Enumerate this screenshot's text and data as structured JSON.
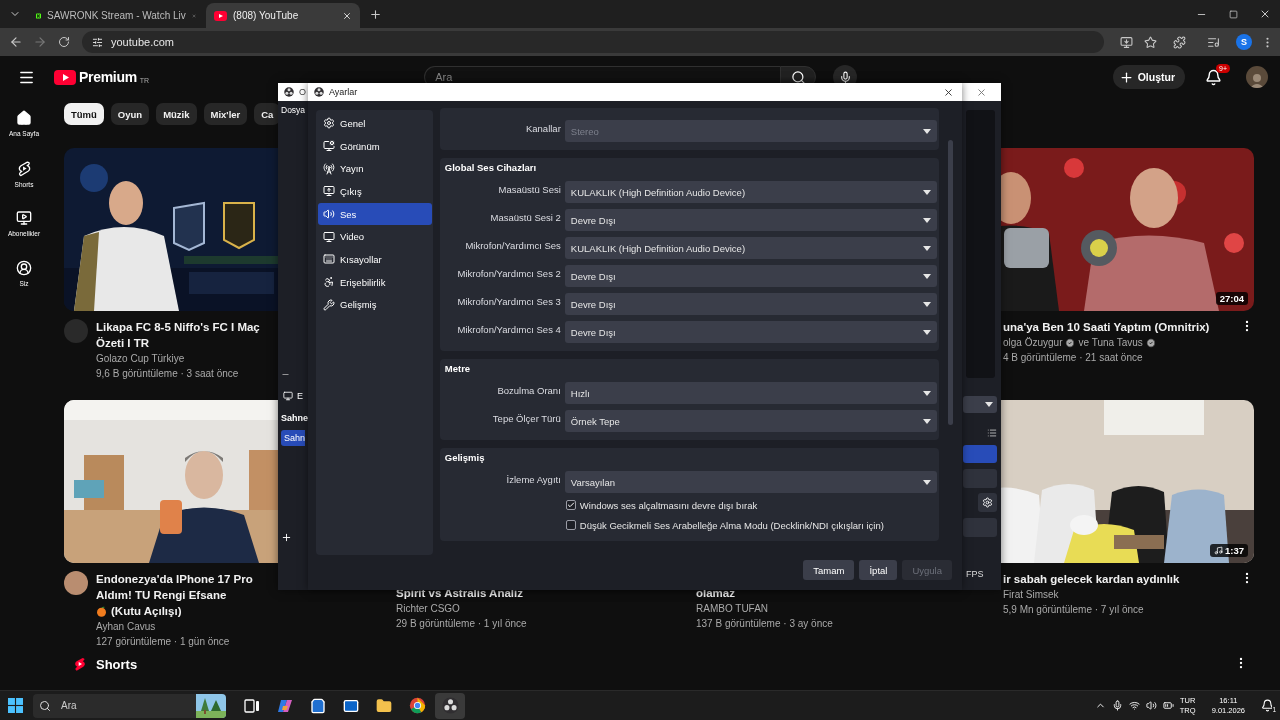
{
  "browser": {
    "tabs": [
      {
        "title": "SAWRONK Stream - Watch Liv",
        "kind": "stream",
        "selected": false
      },
      {
        "title": "(808) YouTube",
        "kind": "video",
        "selected": true
      }
    ],
    "url": "youtube.com",
    "profile_initial": "S"
  },
  "youtube": {
    "logo": "Premium",
    "region": "TR",
    "search": {
      "placeholder": "Ara"
    },
    "create": "Oluştur",
    "notifications": "9+",
    "nav": [
      {
        "label": "Ana Sayfa",
        "kind": "home"
      },
      {
        "label": "Shorts",
        "kind": "shorts"
      },
      {
        "label": "Abonelikler",
        "kind": "subscriptions"
      },
      {
        "label": "Siz",
        "kind": "you"
      }
    ],
    "chips": [
      {
        "label": "Tümü",
        "selected": true
      },
      {
        "label": "Oyun",
        "selected": false
      },
      {
        "label": "Müzik",
        "selected": false
      },
      {
        "label": "Mix'ler",
        "selected": false
      },
      {
        "label": "Ca",
        "selected": false
      }
    ],
    "videos": [
      {
        "thumbnail": {
          "kind": "picture"
        },
        "title": "Likapa FC 8-5 Niffo's FC I Maç Özeti I TR",
        "channel": [
          {
            "name": "Golazo Cup Türkiye"
          }
        ],
        "stats": "9,6 B görüntüleme · 3 saat önce"
      },
      {
        "thumbnail": {
          "kind": "picture",
          "duration": "27:04",
          "music": false
        },
        "title": "una'ya Ben 10 Saati Yaptım (Omnitrix)",
        "channel": [
          {
            "name": "olga Özuygur",
            "verified": true
          },
          {
            "name": "ve Tuna Tavus",
            "verified": true
          }
        ],
        "stats": "4 B görüntüleme · 21 saat önce"
      },
      {
        "thumbnail": {
          "kind": "picture"
        },
        "title": "Endonezya'da IPhone 17 Pro Aldım! TU Rengi Efsane",
        "title_end": "(Kutu Açılışı)",
        "channel": [
          {
            "name": "Ayhan Cavus"
          }
        ],
        "stats": "127 görüntüleme · 1 gün önce"
      },
      {
        "title": "Spirit vs Astralis Analiz",
        "title_starts_hidden": true,
        "channel": [
          {
            "name": "Richter CSGO"
          }
        ],
        "stats": "29 B görüntüleme · 1 yıl önce"
      },
      {
        "title": "olamaz",
        "title_starts_hidden": true,
        "channel": [
          {
            "name": "RAMBO TUFAN"
          }
        ],
        "stats": "137 B görüntüleme · 3 ay önce"
      },
      {
        "thumbnail": {
          "kind": "picture",
          "duration": "1:37",
          "music": true
        },
        "title": "ir sabah gelecek kardan aydınlık",
        "channel": [
          {
            "name": "Firat Simsek"
          }
        ],
        "stats": "5,9 Mn görüntüleme · 7 yıl önce"
      }
    ],
    "shorts_title": "Shorts"
  },
  "obs_main": {
    "title": "O",
    "menu": "Dosya",
    "source_label": "E",
    "scenes_title": "Sahne",
    "scenes": [
      {
        "label": "Sahn",
        "selected": true
      }
    ],
    "fps_label": "FPS"
  },
  "settings": {
    "title": "Ayarlar",
    "nav": [
      {
        "label": "Genel",
        "kind": "general",
        "selected": false
      },
      {
        "label": "Görünüm",
        "kind": "appearance",
        "selected": false
      },
      {
        "label": "Yayın",
        "kind": "stream",
        "selected": false
      },
      {
        "label": "Çıkış",
        "kind": "output",
        "selected": false
      },
      {
        "label": "Ses",
        "kind": "audio",
        "selected": true
      },
      {
        "label": "Video",
        "kind": "video",
        "selected": false
      },
      {
        "label": "Kısayollar",
        "kind": "hotkeys",
        "selected": false
      },
      {
        "label": "Erişebilirlik",
        "kind": "accessibility",
        "selected": false
      },
      {
        "label": "Gelişmiş",
        "kind": "advanced",
        "selected": false
      }
    ],
    "groups": [
      {
        "rows": [
          {
            "kind": "select",
            "label": "Kanallar",
            "value": "Stereo",
            "disabled": true
          }
        ]
      },
      {
        "title": "Global Ses Cihazları",
        "rows": [
          {
            "kind": "select",
            "label": "Masaüstü Sesi",
            "value": "KULAKLIK (High Definition Audio Device)",
            "disabled": false
          },
          {
            "kind": "select",
            "label": "Masaüstü Sesi 2",
            "value": "Devre Dışı",
            "disabled": false
          },
          {
            "kind": "select",
            "label": "Mikrofon/Yardımcı Ses",
            "value": "KULAKLIK (High Definition Audio Device)",
            "disabled": false
          },
          {
            "kind": "select",
            "label": "Mikrofon/Yardımcı Ses 2",
            "value": "Devre Dışı",
            "disabled": false
          },
          {
            "kind": "select",
            "label": "Mikrofon/Yardımcı Ses 3",
            "value": "Devre Dışı",
            "disabled": false
          },
          {
            "kind": "select",
            "label": "Mikrofon/Yardımcı Ses 4",
            "value": "Devre Dışı",
            "disabled": false
          }
        ]
      },
      {
        "title": "Metre",
        "rows": [
          {
            "kind": "select",
            "label": "Bozulma Oranı",
            "value": "Hızlı",
            "disabled": false
          },
          {
            "kind": "select",
            "label": "Tepe Ölçer Türü",
            "value": "Örnek Tepe",
            "disabled": false
          }
        ]
      },
      {
        "title": "Gelişmiş",
        "rows": [
          {
            "kind": "select",
            "label": "İzleme Aygıtı",
            "value": "Varsayılan",
            "disabled": false
          },
          {
            "kind": "checkbox",
            "label": "Windows ses alçaltmasını devre dışı bırak",
            "checked": true
          },
          {
            "kind": "checkbox",
            "label": "Düşük Gecikmeli Ses Arabelleğe Alma Modu (Decklink/NDI çıkışları için)",
            "checked": false
          }
        ]
      }
    ],
    "buttons": [
      {
        "label": "Tamam",
        "disabled": false
      },
      {
        "label": "İptal",
        "disabled": false
      },
      {
        "label": "Uygula",
        "disabled": true
      }
    ]
  },
  "taskbar": {
    "search": {
      "placeholder": "Ara"
    },
    "apps": [
      {
        "kind": "taskview",
        "active": false
      },
      {
        "kind": "assistant",
        "active": false
      },
      {
        "kind": "store",
        "active": false
      },
      {
        "kind": "mail",
        "active": false
      },
      {
        "kind": "files",
        "active": false
      },
      {
        "kind": "browser",
        "active": false
      },
      {
        "kind": "recorder",
        "active": true
      }
    ],
    "input": [
      "TUR",
      "TRQ"
    ],
    "time": "16:11",
    "date": "9.01.2026",
    "notifications": "1"
  }
}
